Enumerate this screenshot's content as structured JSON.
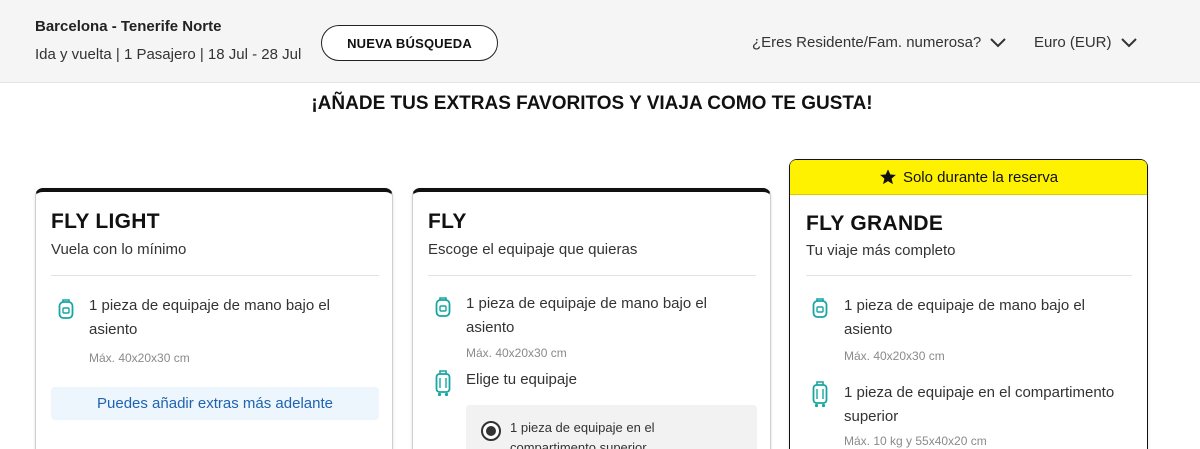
{
  "header": {
    "route": "Barcelona - Tenerife Norte",
    "trip_info": "Ida y vuelta | 1 Pasajero | 18 Jul - 28 Jul",
    "new_search_label": "NUEVA BÚSQUEDA",
    "residency_dropdown": "¿Eres Residente/Fam. numerosa?",
    "currency_dropdown": "Euro (EUR)"
  },
  "headline": "¡AÑADE TUS EXTRAS FAVORITOS Y VIAJA COMO TE GUSTA!",
  "fares": {
    "light": {
      "title": "FLY LIGHT",
      "subtitle": "Vuela con lo mínimo",
      "feature1_line1": "1 pieza de equipaje de mano bajo el",
      "feature1_line2": "asiento",
      "feature1_note": "Máx. 40x20x30 cm",
      "info_text": "Puedes añadir extras más adelante"
    },
    "fly": {
      "title": "FLY",
      "subtitle": "Escoge el equipaje que quieras",
      "feature1_line1": "1 pieza de equipaje de mano bajo el",
      "feature1_line2": "asiento",
      "feature1_note": "Máx. 40x20x30 cm",
      "feature2": "Elige tu equipaje",
      "option1_line1": "1 pieza de equipaje en el",
      "option1_line2": "compartimento superior"
    },
    "grande": {
      "banner": "Solo durante la reserva",
      "title": "FLY GRANDE",
      "subtitle": "Tu viaje más completo",
      "feature1_line1": "1 pieza de equipaje de mano bajo el",
      "feature1_line2": "asiento",
      "feature1_note": "Máx. 40x20x30 cm",
      "feature2_line1": "1 pieza de equipaje en el compartimento",
      "feature2_line2": "superior",
      "feature2_note": "Máx. 10 kg y 55x40x20 cm"
    }
  },
  "icons": {
    "small_bag": "underseat-bag-icon",
    "trolley": "cabin-trolley-icon",
    "star": "star-icon",
    "chevron": "chevron-down-icon"
  },
  "colors": {
    "accent_teal": "#17a6a1",
    "banner_yellow": "#fff200",
    "info_blue": "#1f63b0",
    "info_bg": "#edf5fd"
  }
}
